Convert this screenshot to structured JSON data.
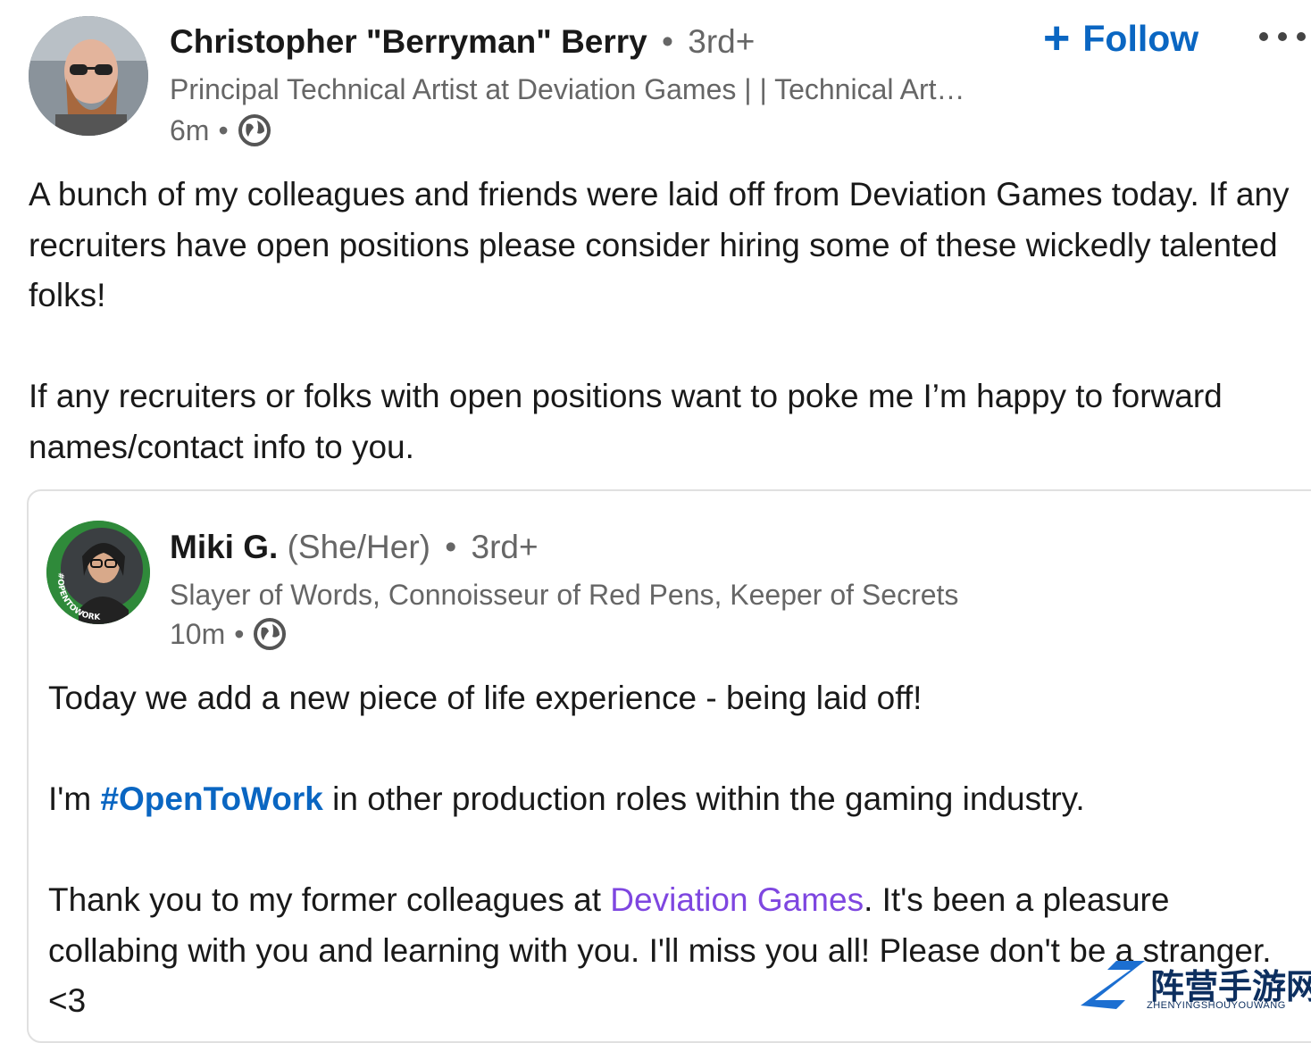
{
  "post": {
    "author_name": "Christopher \"Berryman\" Berry",
    "separator": "•",
    "degree": "3rd+",
    "headline": "Principal Technical Artist at Deviation Games | | Technical Art…",
    "time": "6m",
    "meta_separator": "•",
    "visibility_icon": "globe-icon",
    "follow_plus": "+",
    "follow_label": "Follow",
    "more_icon": "more-horizontal-icon",
    "text": "A bunch of my colleagues and friends were laid off from Deviation Games today. If any recruiters have open positions please consider hiring some of these wickedly talented folks!\n\nIf any recruiters or folks with open positions want to poke me I’m happy to forward names/contact info to you."
  },
  "reshared": {
    "author_name": "Miki G.",
    "pronouns": "(She/Her)",
    "separator": "•",
    "degree": "3rd+",
    "avatar_frame_text": "#OPENTOWORK",
    "headline": "Slayer of Words, Connoisseur of Red Pens, Keeper of Secrets",
    "time": "10m",
    "meta_separator": "•",
    "visibility_icon": "globe-icon",
    "line1": "Today we add a new piece of life experience - being laid off!",
    "line2_prefix": "I'm ",
    "hashtag": "#OpenToWork",
    "line2_suffix": " in other production roles within the gaming industry.",
    "line3_prefix": "Thank you to my former colleagues at ",
    "mention": "Deviation Games",
    "line3_suffix": ". It's been a pleasure collabing with you and learning with you. I'll miss you all! Please don't be a stranger. <3"
  },
  "watermark": {
    "cn": "阵营手游网",
    "en": "ZHENYINGSHOUYOUWANG"
  },
  "colors": {
    "link_blue": "#0a66c2",
    "mention_purple": "#7e46e0",
    "muted": "#666666",
    "open_to_work_green": "#2f8a3a"
  }
}
